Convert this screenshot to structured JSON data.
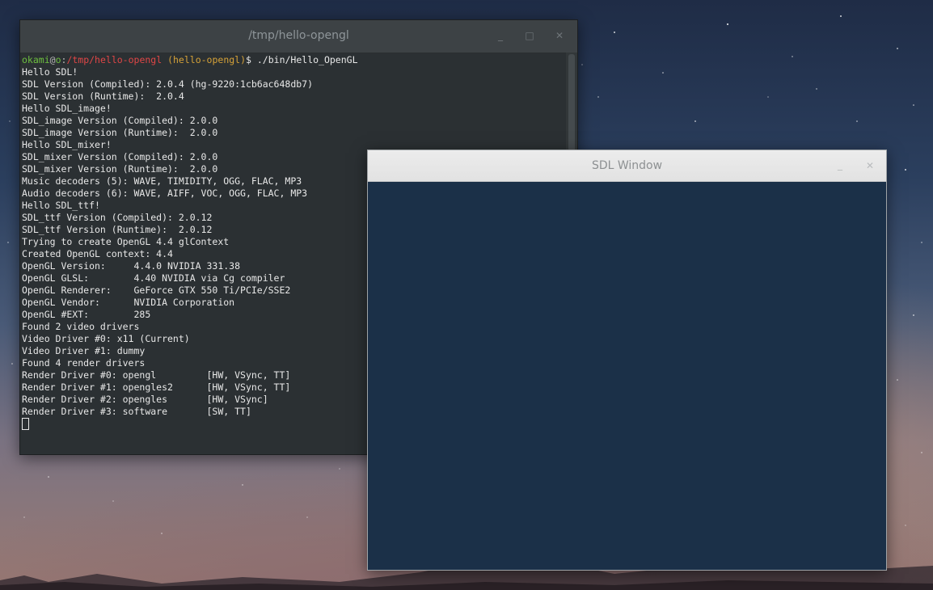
{
  "terminal": {
    "title": "/tmp/hello-opengl",
    "buttons": {
      "minimize": "_",
      "maximize": "□",
      "close": "✕"
    },
    "prompt": {
      "user": "okami",
      "at": "@",
      "host": "o",
      "colon": ":",
      "path": "/tmp/hello-opengl",
      "branch": "(hello-opengl)",
      "symbol": "$",
      "command": " ./bin/Hello_OpenGL"
    },
    "lines": [
      "Hello SDL!",
      "SDL Version (Compiled): 2.0.4 (hg-9220:1cb6ac648db7)",
      "SDL Version (Runtime):  2.0.4",
      "Hello SDL_image!",
      "SDL_image Version (Compiled): 2.0.0",
      "SDL_image Version (Runtime):  2.0.0",
      "Hello SDL_mixer!",
      "SDL_mixer Version (Compiled): 2.0.0",
      "SDL_mixer Version (Runtime):  2.0.0",
      "Music decoders (5): WAVE, TIMIDITY, OGG, FLAC, MP3",
      "Audio decoders (6): WAVE, AIFF, VOC, OGG, FLAC, MP3",
      "Hello SDL_ttf!",
      "SDL_ttf Version (Compiled): 2.0.12",
      "SDL_ttf Version (Runtime):  2.0.12",
      "Trying to create OpenGL 4.4 glContext",
      "Created OpenGL context: 4.4",
      "OpenGL Version:     4.4.0 NVIDIA 331.38",
      "OpenGL GLSL:        4.40 NVIDIA via Cg compiler",
      "OpenGL Renderer:    GeForce GTX 550 Ti/PCIe/SSE2",
      "OpenGL Vendor:      NVIDIA Corporation",
      "OpenGL #EXT:        285",
      "Found 2 video drivers",
      "Video Driver #0: x11 (Current)",
      "Video Driver #1: dummy",
      "Found 4 render drivers",
      "Render Driver #0: opengl         [HW, VSync, TT]",
      "Render Driver #1: opengles2      [HW, VSync, TT]",
      "Render Driver #2: opengles       [HW, VSync]",
      "Render Driver #3: software       [SW, TT]"
    ]
  },
  "sdl_window": {
    "title": "SDL Window",
    "buttons": {
      "minimize": "_",
      "close": "✕"
    },
    "clear_color": "#1b3048"
  }
}
